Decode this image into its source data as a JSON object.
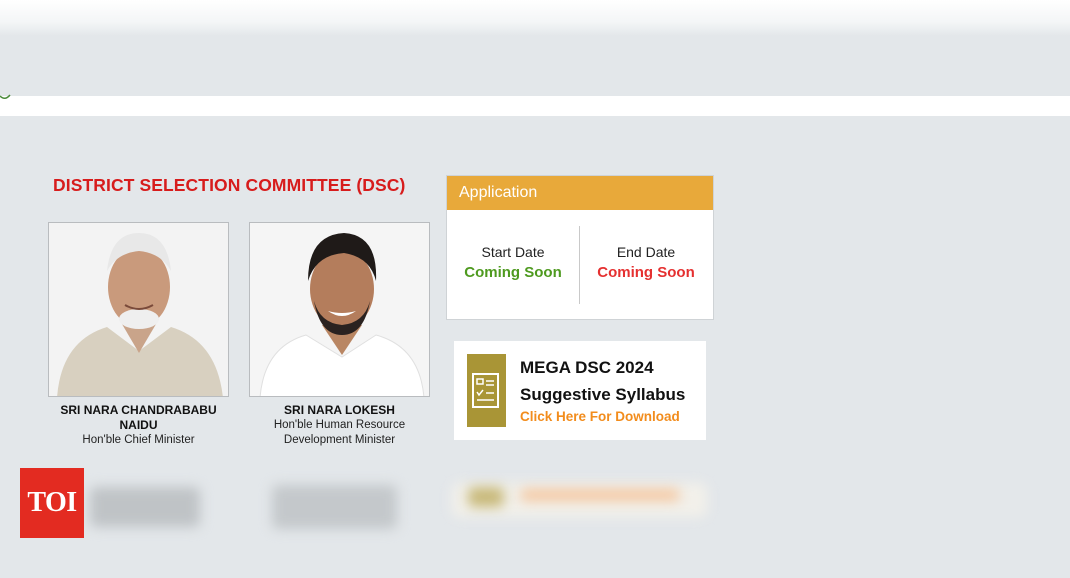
{
  "section_title": "DISTRICT SELECTION COMMITTEE (DSC)",
  "people": [
    {
      "name": "SRI NARA CHANDRABABU NAIDU",
      "role": "Hon'ble Chief Minister"
    },
    {
      "name": "SRI NARA LOKESH",
      "role": "Hon'ble Human Resource Development Minister"
    }
  ],
  "application": {
    "title": "Application",
    "start_label": "Start Date",
    "start_value": "Coming Soon",
    "end_label": "End Date",
    "end_value": "Coming Soon"
  },
  "syllabus": {
    "title_line1": "MEGA DSC 2024",
    "title_line2": "Suggestive Syllabus",
    "link": "Click Here For Download",
    "icon": "syllabus-document-icon"
  },
  "watermark": {
    "label": "TOI"
  },
  "colors": {
    "title_red": "#d71c1c",
    "app_header": "#e8a93a",
    "start_green": "#4e9a1f",
    "end_red": "#e53030",
    "link_orange": "#f28c1c",
    "icon_olive": "#a99536",
    "toi_red": "#e32b21"
  }
}
